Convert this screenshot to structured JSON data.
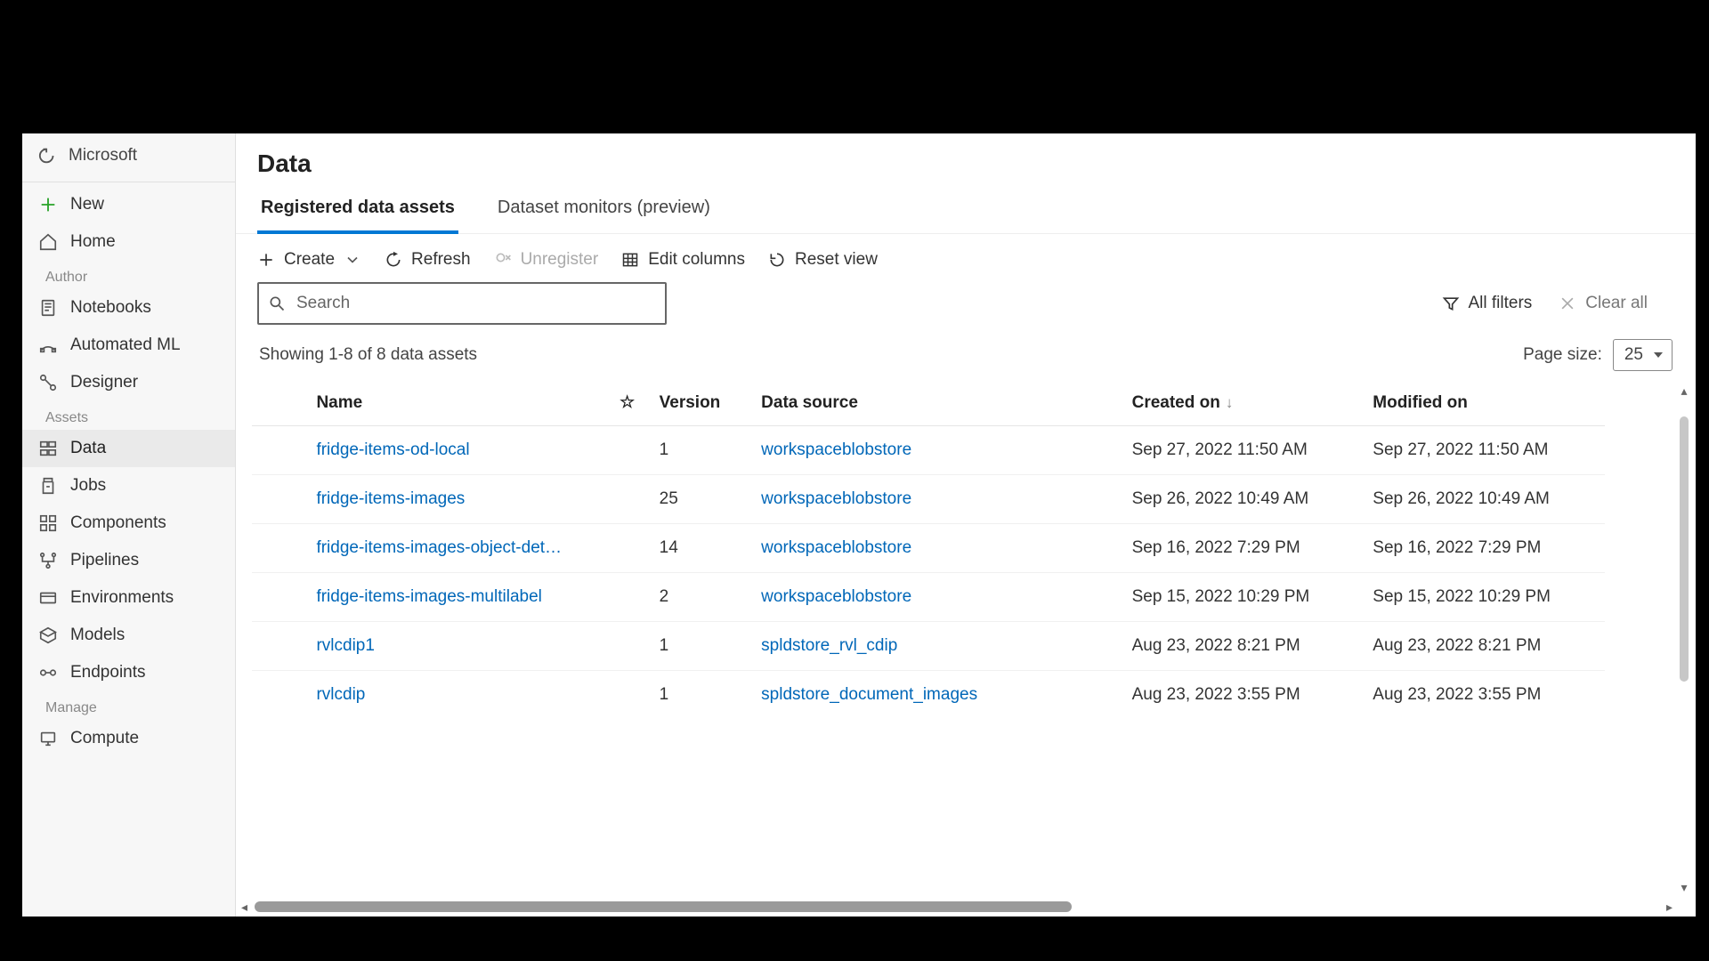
{
  "workspace": {
    "name": "Microsoft"
  },
  "sidebar": {
    "new_label": "New",
    "home_label": "Home",
    "group_author": "Author",
    "notebooks_label": "Notebooks",
    "automl_label": "Automated ML",
    "designer_label": "Designer",
    "group_assets": "Assets",
    "data_label": "Data",
    "jobs_label": "Jobs",
    "components_label": "Components",
    "pipelines_label": "Pipelines",
    "environments_label": "Environments",
    "models_label": "Models",
    "endpoints_label": "Endpoints",
    "group_manage": "Manage",
    "compute_label": "Compute"
  },
  "page": {
    "title": "Data"
  },
  "tabs": {
    "registered": "Registered data assets",
    "monitors": "Dataset monitors (preview)"
  },
  "toolbar": {
    "create": "Create",
    "refresh": "Refresh",
    "unregister": "Unregister",
    "edit_columns": "Edit columns",
    "reset_view": "Reset view"
  },
  "search": {
    "placeholder": "Search"
  },
  "filters": {
    "all_filters": "All filters",
    "clear_all": "Clear all"
  },
  "status": {
    "showing": "Showing 1-8 of 8 data assets"
  },
  "page_size": {
    "label": "Page size:",
    "value": "25"
  },
  "columns": {
    "name": "Name",
    "version": "Version",
    "data_source": "Data source",
    "created_on": "Created on",
    "modified_on": "Modified on"
  },
  "rows": [
    {
      "name": "fridge-items-od-local",
      "version": "1",
      "source": "workspaceblobstore",
      "created": "Sep 27, 2022 11:50 AM",
      "modified": "Sep 27, 2022 11:50 AM"
    },
    {
      "name": "fridge-items-images",
      "version": "25",
      "source": "workspaceblobstore",
      "created": "Sep 26, 2022 10:49 AM",
      "modified": "Sep 26, 2022 10:49 AM"
    },
    {
      "name": "fridge-items-images-object-det…",
      "version": "14",
      "source": "workspaceblobstore",
      "created": "Sep 16, 2022 7:29 PM",
      "modified": "Sep 16, 2022 7:29 PM"
    },
    {
      "name": "fridge-items-images-multilabel",
      "version": "2",
      "source": "workspaceblobstore",
      "created": "Sep 15, 2022 10:29 PM",
      "modified": "Sep 15, 2022 10:29 PM"
    },
    {
      "name": "rvlcdip1",
      "version": "1",
      "source": "spldstore_rvl_cdip",
      "created": "Aug 23, 2022 8:21 PM",
      "modified": "Aug 23, 2022 8:21 PM"
    },
    {
      "name": "rvlcdip",
      "version": "1",
      "source": "spldstore_document_images",
      "created": "Aug 23, 2022 3:55 PM",
      "modified": "Aug 23, 2022 3:55 PM"
    }
  ]
}
